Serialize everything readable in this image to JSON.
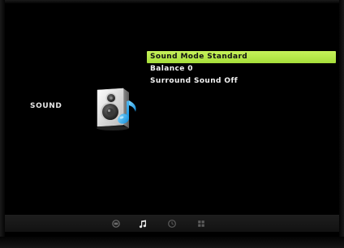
{
  "section": {
    "label": "SOUND",
    "icon": "speaker-music-note-icon"
  },
  "menu": {
    "items": [
      {
        "label": "Sound Mode Standard",
        "selected": true
      },
      {
        "label": "Balance 0",
        "selected": false
      },
      {
        "label": "Surround Sound Off",
        "selected": false
      }
    ],
    "highlight_color": "#b4e84a"
  },
  "bottom_bar": {
    "icons": [
      {
        "name": "picture-icon",
        "active": false
      },
      {
        "name": "music-note-icon",
        "active": true
      },
      {
        "name": "clock-icon",
        "active": false
      },
      {
        "name": "grid-icon",
        "active": false
      }
    ]
  }
}
